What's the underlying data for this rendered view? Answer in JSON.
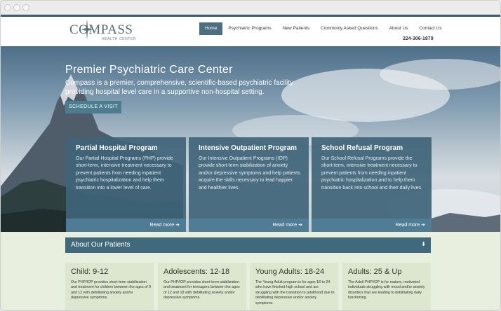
{
  "header": {
    "logo_text": "COMPASS",
    "logo_sub": "HEALTH CENTER",
    "nav": [
      {
        "label": "Home"
      },
      {
        "label": "Psychiatric Programs"
      },
      {
        "label": "New Patients"
      },
      {
        "label": "Commonly Asked Questions"
      },
      {
        "label": "About Us"
      },
      {
        "label": "Contact Us"
      }
    ],
    "phone": "224-306-1879"
  },
  "hero": {
    "title": "Premier Psychiatric Care Center",
    "subtitle": "Compass is a premier, comprehensive, scientific-based psychiatric facility providing hospital level care in a supportive non-hospital setting.",
    "cta": "SCHEDULE A VISIT"
  },
  "cards": [
    {
      "title": "Partial Hospital Program",
      "body": "Our Partial Hospital Programs (PHP) provide short-term, intensive treatment necessary to prevent patients from needing inpatient psychiatric hospitalization and help them transition into a lower level of care.",
      "more": "Read more"
    },
    {
      "title": "Intensive Outpatient Program",
      "body": "Our Intensive Outpatient Programs (IOP) provide short-term stabilization of anxiety and/or depressive symptoms and help patients acquire the skills necessary to lead happier and healthier lives.",
      "more": "Read more"
    },
    {
      "title": "School Refusal Program",
      "body": "Our School Refusal Programs provide the short-term, intensive treatment necessary to prevent patients from needing inpatient psychiatric hospitalization and to help them transition back into school and their daily lives.",
      "more": "Read more"
    }
  ],
  "about": {
    "title": "About Our Patients",
    "arrow": "⬇"
  },
  "patients": [
    {
      "title": "Child: 9-12",
      "body": "Our PHP/IOP provides short-term stabilization and treatment for children between the ages of 9 and 12 with debilitating anxiety and/or depressive symptoms."
    },
    {
      "title": "Adolescents: 12-18",
      "body": "Our PHP/IOP provides short-term stabilization and treatment for teenagers between the ages of 12 and 18 with debilitating anxiety and/or depressive symptoms."
    },
    {
      "title": "Young Adults: 18-24",
      "body": "The Young Adult program is for ages 18 to 24 who have finished high school and are struggling with the transition to adulthood due to debilitating depressive and/or anxiety symptoms."
    },
    {
      "title": "Adults: 25 & Up",
      "body": "The Adult PHP/IOP is for mature, motivated individuals struggling with mood and/or anxiety disorders that are leading to debilitating daily functioning."
    }
  ],
  "colors": {
    "primary": "#41697c",
    "card": "#3f6478",
    "nav_active": "#4b6e80",
    "panel": "#dde7cf",
    "background_lower": "#e9efdf"
  },
  "icons": {
    "arrow_right": "arrow-right-icon",
    "arrow_down": "arrow-down-icon",
    "compass_star": "compass-star-icon"
  }
}
